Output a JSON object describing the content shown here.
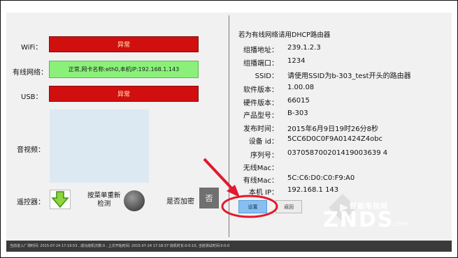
{
  "left": {
    "wifi_label": "WiFi：",
    "wifi_status": "异常",
    "wired_label": "有线网络：",
    "wired_status": "正常,网卡名称:eth0,本机IP:192.168.1.143",
    "usb_label": "USB：",
    "usb_status": "异常",
    "av_label": "音视频：",
    "remote_label": "遥控器：",
    "keycheck_label": "按菜单重新\n检测",
    "encrypt_label": "是否加密",
    "encrypt_value": "否"
  },
  "right": {
    "intro": "若为有线网络请用DHCP路由器",
    "rows": [
      {
        "key": "组播地址：",
        "value": "239.1.2.3"
      },
      {
        "key": "组播端口：",
        "value": "1234"
      },
      {
        "key": "SSID：",
        "value": "请使用SSID为b-303_test开头的路由器"
      },
      {
        "key": "软件版本：",
        "value": "1.00.08"
      },
      {
        "key": "硬件版本：",
        "value": "66015"
      },
      {
        "key": "产品型号：",
        "value": "B-303"
      },
      {
        "key": "发布时间：",
        "value": "2015年6月9日19时26分8秒"
      },
      {
        "key": "设备 id：",
        "value": "5CC6D0C0F9A01424Z4obc"
      },
      {
        "key": "序列号：",
        "value": "037058700201419003639 4"
      },
      {
        "key": "无线Mac：",
        "value": ""
      },
      {
        "key": "有线Mac：",
        "value": "5C:C6:D0:C0:F9:A0"
      },
      {
        "key": "本机 IP：",
        "value": "192.168.1 143"
      }
    ],
    "set_label": "设置",
    "back_label": "返回"
  },
  "bottom": {
    "status": "当前进入厂测时间: 2015-07-24 17:19:53 , 成功烧机次数:0 , 上次开始时间: 2015-07-24 17:18:37 烧机时长:0:0:10,          当前测试时间:0:0:0"
  },
  "watermark": {
    "site": "智能电视网",
    "brand": "ZNDS",
    "suffix": ".com"
  },
  "colors": {
    "error_red": "#d10f0f",
    "ok_green": "#8af07a",
    "annotation_red": "#e3182c",
    "set_blue": "#87bff2"
  }
}
